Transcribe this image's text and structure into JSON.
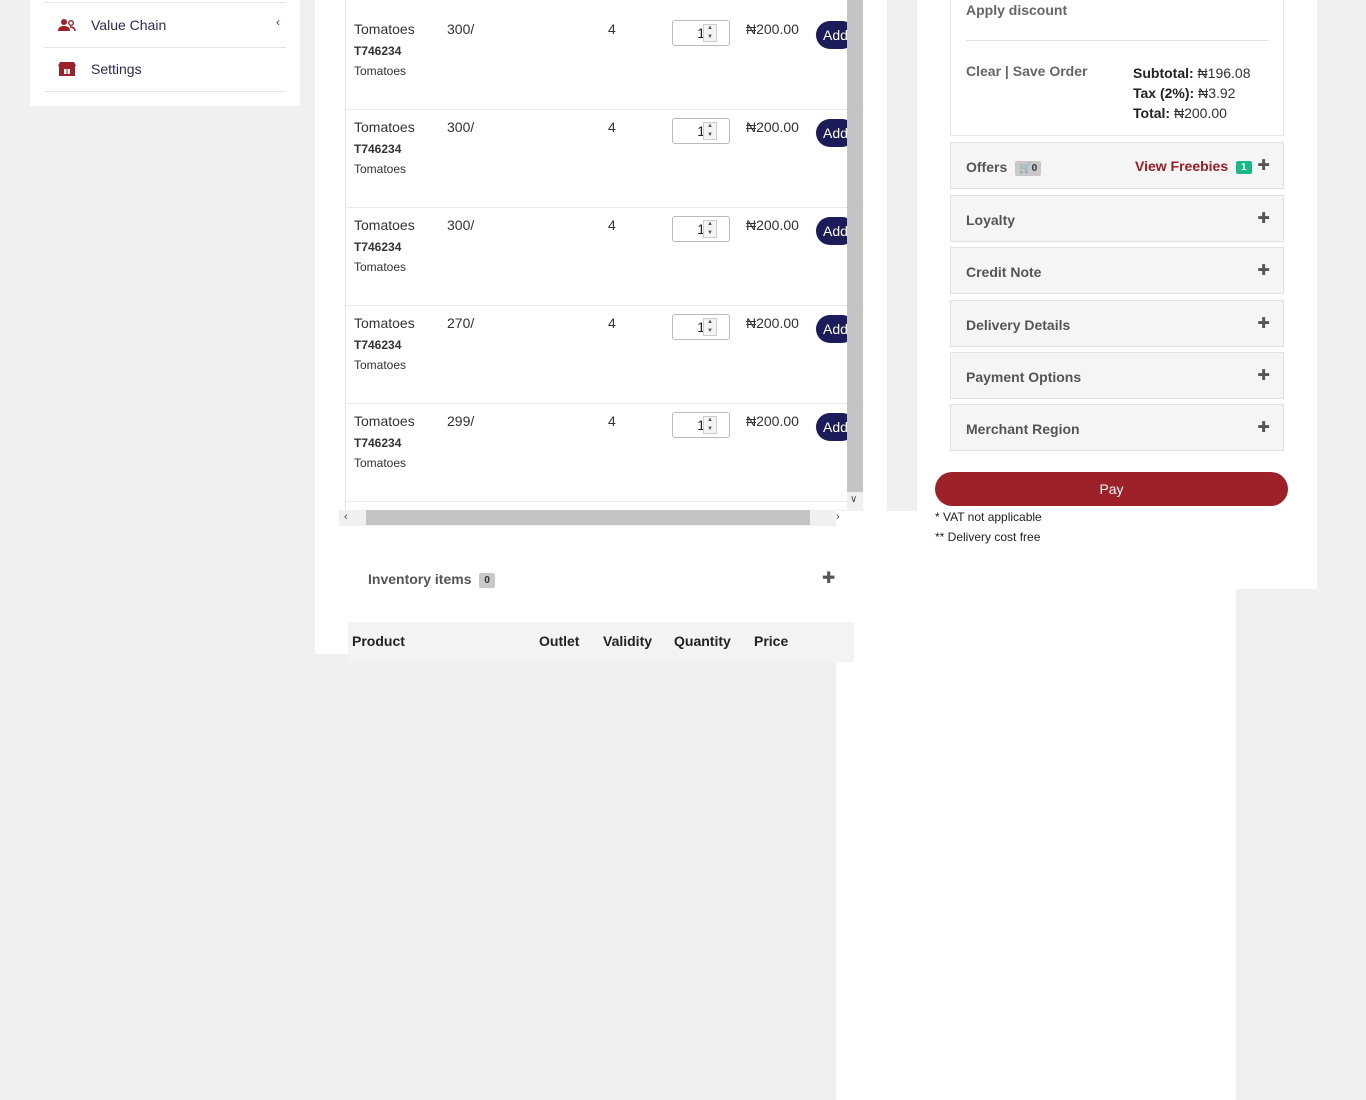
{
  "sidebar": {
    "items": [
      {
        "label": "Value Chain",
        "icon": "users-icon",
        "has_chevron": true
      },
      {
        "label": "Settings",
        "icon": "store-icon",
        "has_chevron": false
      }
    ],
    "accent": "#9e2129"
  },
  "product_rows": [
    {
      "name": "Tomatoes",
      "sku": "T746234",
      "desc": "Tomatoes",
      "price": "300/",
      "qty": "4",
      "stepper": "1",
      "total": "₦200.00",
      "action": "Add"
    },
    {
      "name": "Tomatoes",
      "sku": "T746234",
      "desc": "Tomatoes",
      "price": "300/",
      "qty": "4",
      "stepper": "1",
      "total": "₦200.00",
      "action": "Add"
    },
    {
      "name": "Tomatoes",
      "sku": "T746234",
      "desc": "Tomatoes",
      "price": "300/",
      "qty": "4",
      "stepper": "1",
      "total": "₦200.00",
      "action": "Add"
    },
    {
      "name": "Tomatoes",
      "sku": "T746234",
      "desc": "Tomatoes",
      "price": "270/",
      "qty": "4",
      "stepper": "1",
      "total": "₦200.00",
      "action": "Add"
    },
    {
      "name": "Tomatoes",
      "sku": "T746234",
      "desc": "Tomatoes",
      "price": "299/",
      "qty": "4",
      "stepper": "1",
      "total": "₦200.00",
      "action": "Add"
    }
  ],
  "inventory": {
    "title": "Inventory items",
    "count": "0",
    "columns": [
      "Product",
      "Outlet",
      "Validity",
      "Quantity",
      "Price"
    ]
  },
  "summary": {
    "apply_discount": "Apply discount",
    "clear": "Clear",
    "separator": "|",
    "save_order": "Save Order",
    "subtotal_label": "Subtotal:",
    "subtotal_value": "₦196.08",
    "tax_label": "Tax (2%):",
    "tax_value": "₦3.92",
    "total_label": "Total:",
    "total_value": "₦200.00"
  },
  "offers": {
    "label": "Offers",
    "cart_count": "0",
    "freebies_label": "View Freebies",
    "freebies_count": "1"
  },
  "accordions": [
    "Loyalty",
    "Credit Note",
    "Delivery Details",
    "Payment Options",
    "Merchant Region"
  ],
  "pay_label": "Pay",
  "notes": [
    "* VAT not applicable",
    "** Delivery cost free"
  ]
}
